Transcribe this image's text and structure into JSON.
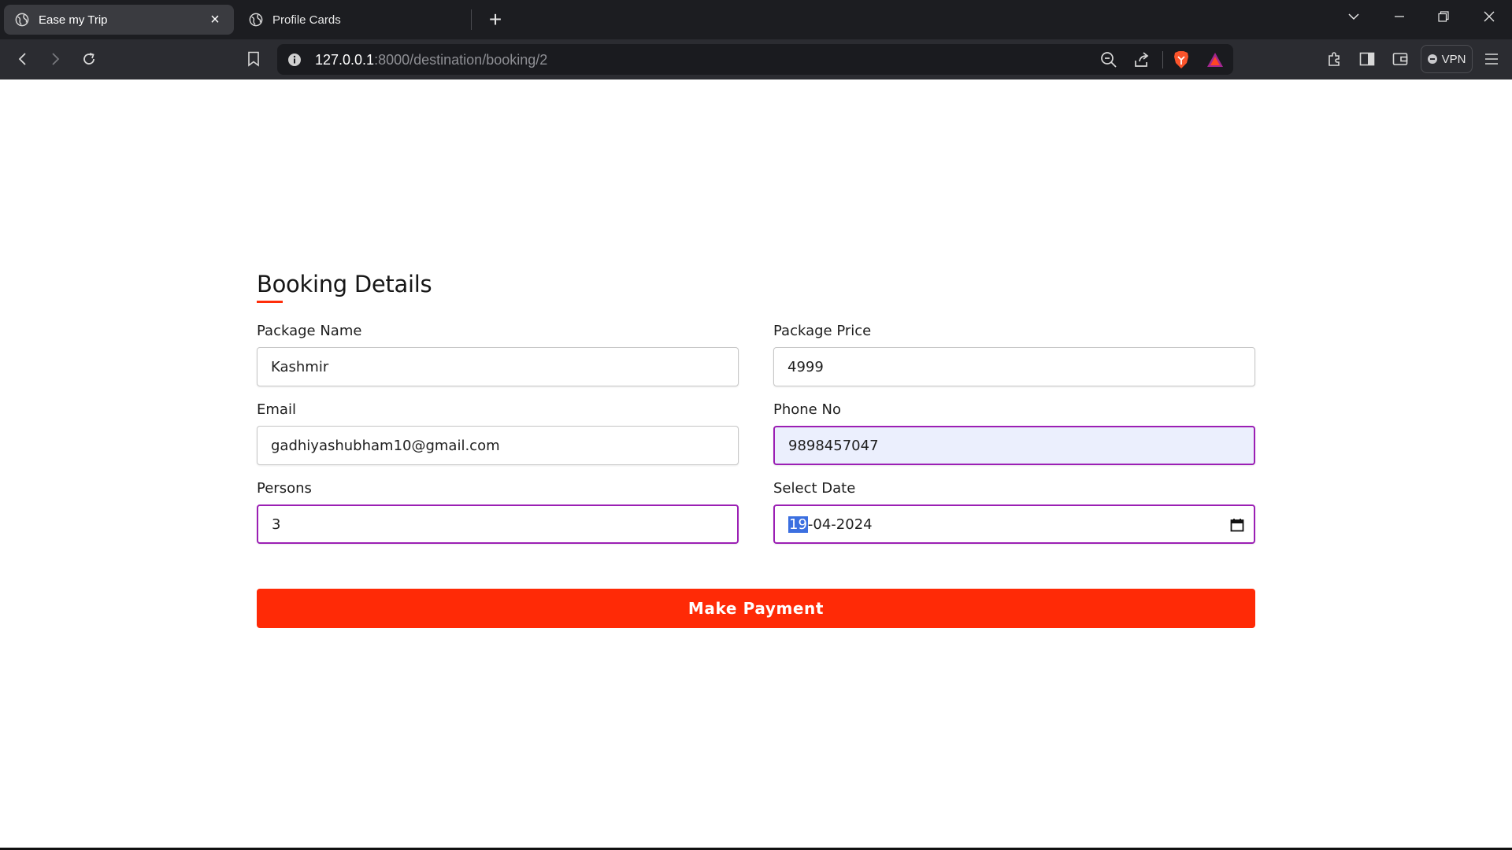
{
  "browser": {
    "tabs": [
      {
        "title": "Ease my Trip",
        "active": true,
        "close": "×"
      },
      {
        "title": "Profile Cards",
        "active": false
      }
    ],
    "new_tab": "+",
    "url_host": "127.0.0.1",
    "url_rest": ":8000/destination/booking/2",
    "vpn_label": "VPN"
  },
  "form": {
    "title": "Booking Details",
    "package_name_label": "Package Name",
    "package_name_value": "Kashmir",
    "package_price_label": "Package Price",
    "package_price_value": "4999",
    "email_label": "Email",
    "email_value": "gadhiyashubham10@gmail.com",
    "phone_label": "Phone No",
    "phone_value": "9898457047",
    "persons_label": "Persons",
    "persons_value": "3",
    "date_label": "Select Date",
    "date_day": "19",
    "date_rest": "-04-2024",
    "submit_label": "Make Payment"
  },
  "colors": {
    "accent": "#ff2a06",
    "focus_border": "#9b1fb4",
    "autofill_bg": "#ebeffd",
    "chrome_dark": "#1c1d21"
  }
}
